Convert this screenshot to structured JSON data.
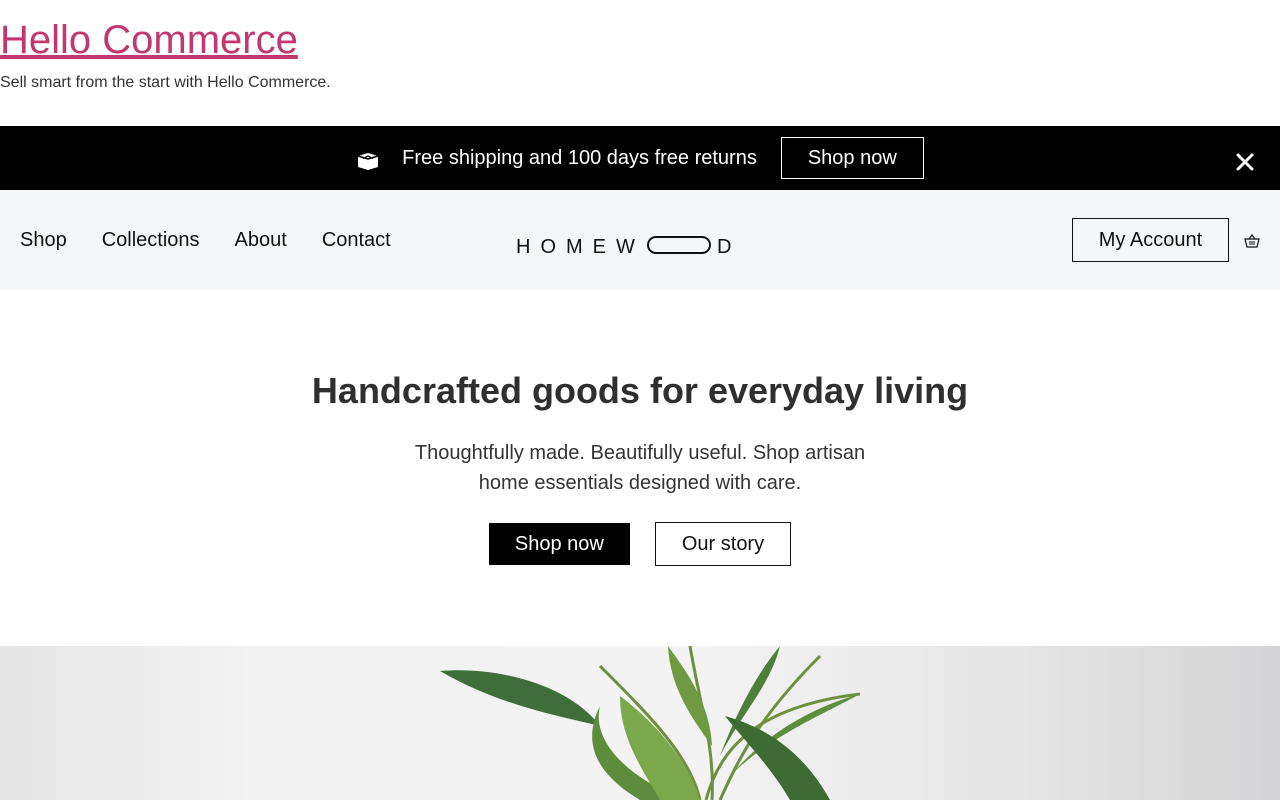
{
  "site": {
    "title": "Hello Commerce",
    "tagline": "Sell smart from the start with Hello Commerce."
  },
  "promo": {
    "icon": "box-icon",
    "text": "Free shipping and 100 days free returns",
    "button_label": "Shop now",
    "close_icon": "close-icon"
  },
  "nav": {
    "links": [
      "Shop",
      "Collections",
      "About",
      "Contact"
    ],
    "logo_text": "HOMEWOOD",
    "account_label": "My Account",
    "cart_icon": "basket-icon"
  },
  "hero": {
    "title": "Handcrafted goods for everyday living",
    "subtitle": "Thoughtfully made. Beautifully useful. Shop artisan home essentials designed with care.",
    "primary_label": "Shop now",
    "secondary_label": "Our story"
  },
  "colors": {
    "site_title": "#c3366f",
    "promo_bg": "#000000",
    "nav_bg": "#f4f6f8",
    "text": "#333333"
  }
}
